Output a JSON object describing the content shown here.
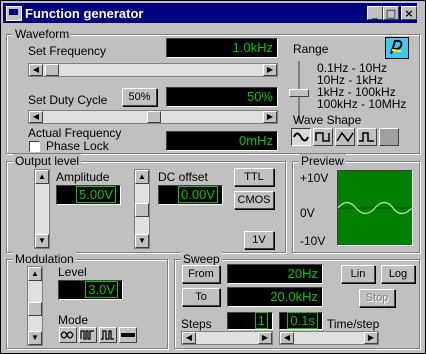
{
  "window": {
    "title": "Function generator",
    "min": "_",
    "max": "□",
    "close": "×"
  },
  "waveform": {
    "group_title": "Waveform",
    "set_frequency_label": "Set Frequency",
    "frequency_value": "1.0kHz",
    "set_duty_label": "Set Duty Cycle",
    "duty_button": "50%",
    "duty_value": "50%",
    "actual_frequency_label": "Actual Frequency",
    "phase_lock_label": "Phase Lock",
    "actual_value": "0mHz",
    "range_label": "Range",
    "ranges": [
      "0.1Hz - 10Hz",
      "10Hz - 1kHz",
      "1kHz - 100kHz",
      "100kHz - 10MHz"
    ],
    "wave_shape_label": "Wave Shape"
  },
  "output": {
    "group_title": "Output level",
    "amplitude_label": "Amplitude",
    "amplitude_value": "5.00V",
    "dc_offset_label": "DC offset",
    "dc_offset_value": "0.00V",
    "ttl_button": "TTL",
    "cmos_button": "CMOS",
    "onev_button": "1V"
  },
  "preview": {
    "group_title": "Preview",
    "top_label": "+10V",
    "mid_label": "0V",
    "bottom_label": "-10V"
  },
  "modulation": {
    "group_title": "Modulation",
    "level_label": "Level",
    "level_value": "3.0V",
    "mode_label": "Mode"
  },
  "sweep": {
    "group_title": "Sweep",
    "from_button": "From",
    "from_value": "20Hz",
    "to_button": "To",
    "to_value": "20.0kHz",
    "lin_button": "Lin",
    "log_button": "Log",
    "stop_button": "Stop",
    "steps_label": "Steps",
    "steps_value": "1",
    "time_value": "0.1s",
    "time_step_label": "Time/step"
  },
  "colors": {
    "title_bg": "#000080",
    "lcd_bg": "#000000",
    "lcd_fg": "#00c800",
    "preview_bg": "#008000",
    "wave": "#b0f0b0"
  }
}
